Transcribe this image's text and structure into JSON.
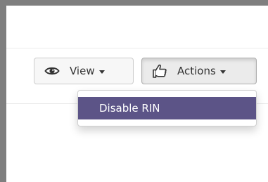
{
  "toolbar": {
    "view_button": {
      "icon": "eye-icon",
      "label": "View"
    },
    "actions_button": {
      "icon": "hand-pointer-icon",
      "label": "Actions"
    }
  },
  "actions_menu": {
    "items": [
      {
        "label": "Disable RIN"
      }
    ]
  },
  "colors": {
    "frame": "#7f7f7f",
    "menu_highlight": "#5c5487",
    "menu_highlight_text": "#ffffff",
    "button_bg": "#f7f7f7",
    "button_border": "#cccccc"
  }
}
